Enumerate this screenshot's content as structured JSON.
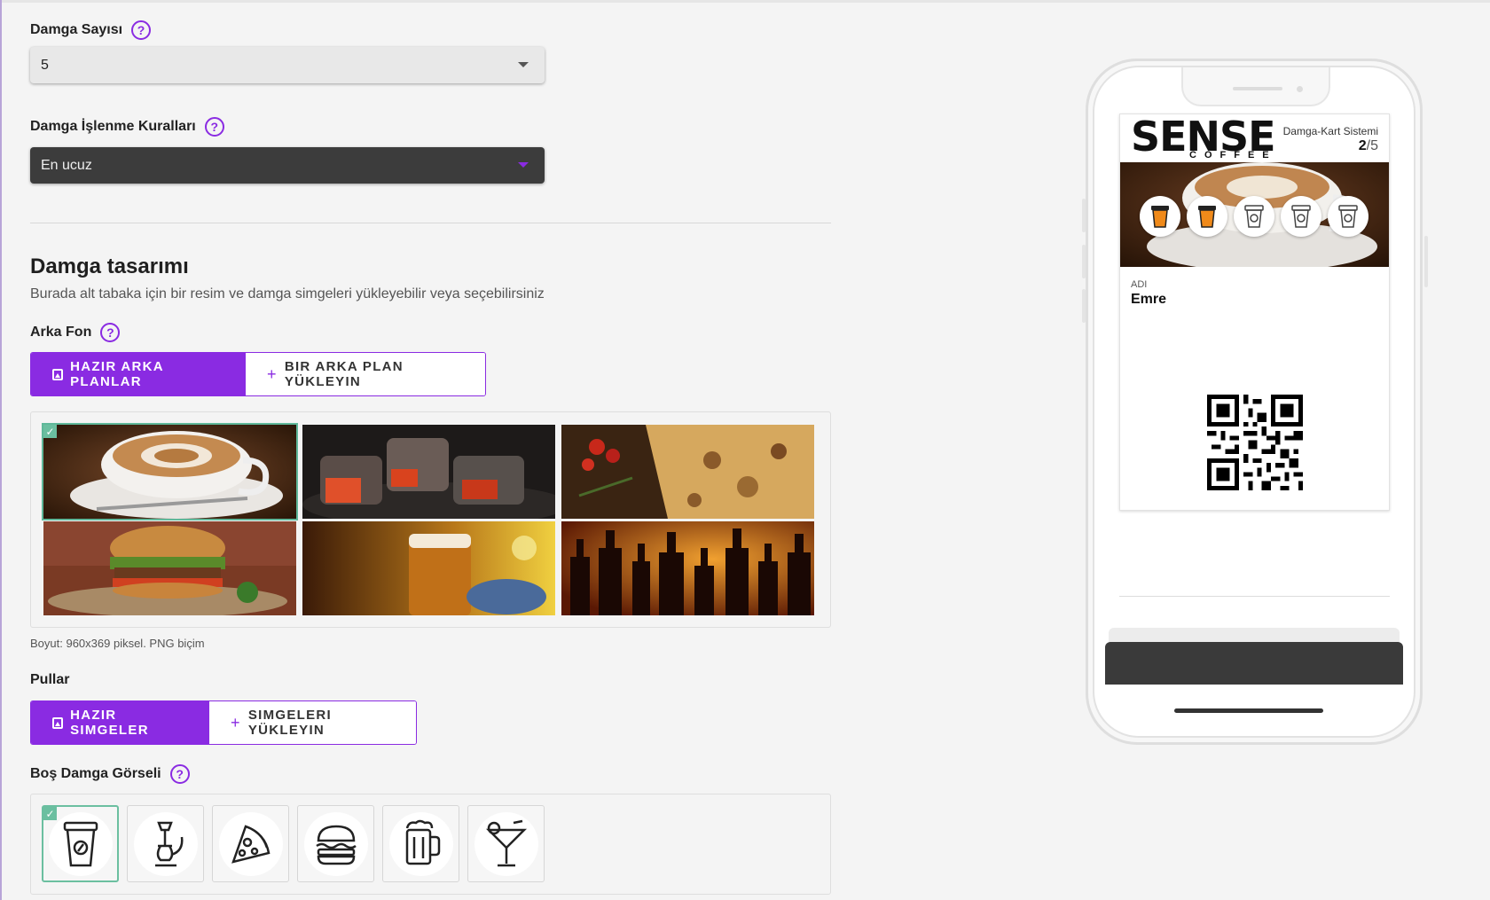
{
  "stamp_count": {
    "label": "Damga Sayısı",
    "help": "?",
    "value": "5"
  },
  "stamp_rules": {
    "label": "Damga İşlenme Kuralları",
    "help": "?",
    "value": "En ucuz"
  },
  "design": {
    "title": "Damga tasarımı",
    "subtitle": "Burada alt tabaka için bir resim ve damga simgeleri yükleyebilir veya seçebilirsiniz"
  },
  "background": {
    "label": "Arka Fon",
    "help": "?",
    "ready_button": "HAZIR ARKA PLANLAR",
    "upload_button": "BIR ARKA PLAN YÜKLEYIN",
    "thumbnails": [
      {
        "name": "coffee",
        "selected": true
      },
      {
        "name": "coals",
        "selected": false
      },
      {
        "name": "pizza",
        "selected": false
      },
      {
        "name": "burger",
        "selected": false
      },
      {
        "name": "beer",
        "selected": false
      },
      {
        "name": "bottles",
        "selected": false
      }
    ],
    "hint": "Boyut: 960x369 piksel. PNG biçim"
  },
  "stamps": {
    "label": "Pullar",
    "ready_button": "HAZIR SIMGELER",
    "upload_button": "SIMGELERI YÜKLEYIN"
  },
  "empty_stamp": {
    "label": "Boş Damga Görseli",
    "help": "?",
    "icons": [
      "coffee-cup-icon",
      "hookah-icon",
      "pizza-icon",
      "burger-icon",
      "beer-mug-icon",
      "cocktail-icon"
    ],
    "selected_index": 0
  },
  "check_mark": "✓",
  "plus": "+",
  "preview": {
    "brand": "SENSE",
    "brand_sub": "COFFEE",
    "system_label": "Damga-Kart Sistemi",
    "count_current": "2",
    "count_total": "/5",
    "stamps_filled": 2,
    "stamps_total": 5,
    "name_label": "ADI",
    "name_value": "Emre"
  },
  "colors": {
    "accent": "#8a2be2",
    "selected": "#6bbfa0",
    "dark_select": "#3c3c3c"
  }
}
